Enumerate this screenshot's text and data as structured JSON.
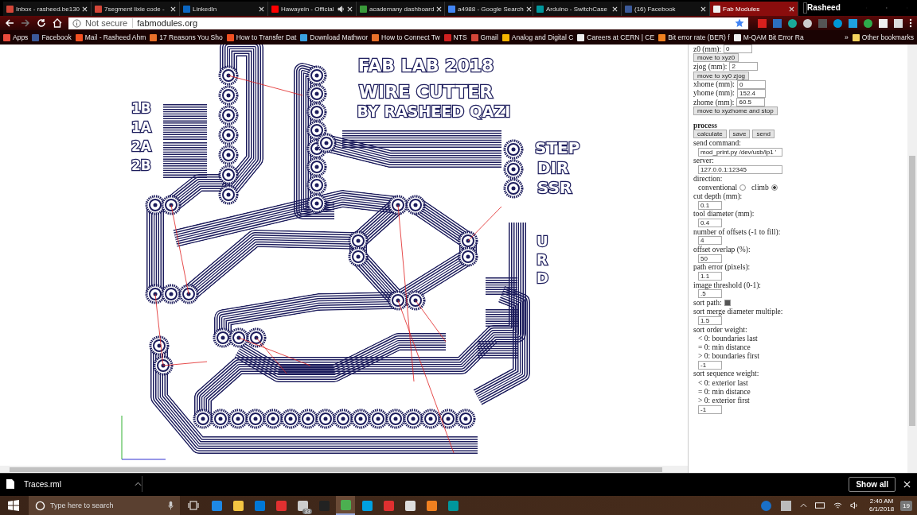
{
  "tabs": [
    {
      "title": "Inbox - rasheed.be130",
      "selected": false,
      "audio": false
    },
    {
      "title": "7segment lixie code -",
      "selected": false,
      "audio": false
    },
    {
      "title": "LinkedIn",
      "selected": false,
      "audio": false
    },
    {
      "title": "Hawayein - Official",
      "selected": false,
      "audio": true
    },
    {
      "title": "academany dashboard",
      "selected": false,
      "audio": false
    },
    {
      "title": "a4988 - Google Search",
      "selected": false,
      "audio": false
    },
    {
      "title": "Arduino - SwitchCase",
      "selected": false,
      "audio": false
    },
    {
      "title": "(16) Facebook",
      "selected": false,
      "audio": false
    },
    {
      "title": "Fab Modules",
      "selected": true,
      "audio": false
    }
  ],
  "profile": "Rasheed",
  "address": {
    "security": "Not secure",
    "url": "fabmodules.org"
  },
  "bookmarks": [
    "Apps",
    "Facebook",
    "Mail - Rasheed Ahm",
    "17 Reasons You Sho",
    "How to Transfer Dat",
    "Download Mathwor",
    "How to Connect Tw",
    "NTS",
    "Gmail",
    "Analog and Digital C",
    "Careers at CERN | CE",
    "Bit error rate (BER) f",
    "M-QAM Bit Error Ra"
  ],
  "bookmarks_more": "»",
  "other_bookmarks": "Other bookmarks",
  "board": {
    "labels": [
      "FAB LAB 2018",
      "WIRE CUTTER",
      "BY RASHEED QAZI",
      "STEP",
      "DIR",
      "SSR",
      "U",
      "R",
      "D",
      "1B",
      "1A",
      "2A",
      "2B"
    ]
  },
  "panel": [
    {
      "kind": "field",
      "label": "z0 (mm):",
      "value": "0"
    },
    {
      "kind": "button",
      "label": "move to xyz0"
    },
    {
      "kind": "field",
      "label": "zjog (mm):",
      "value": "2"
    },
    {
      "kind": "button",
      "label": "move to xy0 zjog"
    },
    {
      "kind": "field",
      "label": "xhome (mm):",
      "value": "0"
    },
    {
      "kind": "field",
      "label": "yhome (mm):",
      "value": "152.4"
    },
    {
      "kind": "field",
      "label": "zhome (mm):",
      "value": "60.5"
    },
    {
      "kind": "button",
      "label": "move to xyzhome and stop"
    },
    {
      "kind": "heading",
      "label": "process"
    },
    {
      "kind": "buttons",
      "labels": [
        "calculate",
        "save",
        "send"
      ]
    },
    {
      "kind": "label",
      "label": "send command:"
    },
    {
      "kind": "longinput",
      "value": "mod_print.py /dev/usb/lp1 '"
    },
    {
      "kind": "label",
      "label": "server:"
    },
    {
      "kind": "longinput",
      "value": "127.0.0.1:12345"
    },
    {
      "kind": "label",
      "label": "direction:"
    },
    {
      "kind": "radio",
      "options": [
        {
          "label": "conventional",
          "selected": false
        },
        {
          "label": "climb",
          "selected": true
        }
      ]
    },
    {
      "kind": "label",
      "label": "cut depth (mm):"
    },
    {
      "kind": "input",
      "value": "0.1"
    },
    {
      "kind": "label",
      "label": "tool diameter (mm):"
    },
    {
      "kind": "input",
      "value": "0.4"
    },
    {
      "kind": "label",
      "label": "number of offsets (-1 to fill):"
    },
    {
      "kind": "input",
      "value": "4"
    },
    {
      "kind": "label",
      "label": "offset overlap (%):"
    },
    {
      "kind": "input",
      "value": "50"
    },
    {
      "kind": "label",
      "label": "path error (pixels):"
    },
    {
      "kind": "input",
      "value": "1.1"
    },
    {
      "kind": "label",
      "label": "image threshold (0-1):"
    },
    {
      "kind": "input",
      "value": ".5"
    },
    {
      "kind": "checkbox",
      "label": "sort path:",
      "checked": true
    },
    {
      "kind": "label",
      "label": "sort merge diameter multiple:"
    },
    {
      "kind": "input",
      "value": "1.5"
    },
    {
      "kind": "label",
      "label": "sort order weight:"
    },
    {
      "kind": "note",
      "label": "< 0: boundaries last"
    },
    {
      "kind": "note",
      "label": "= 0: min distance"
    },
    {
      "kind": "note",
      "label": "> 0: boundaries first"
    },
    {
      "kind": "input",
      "value": "-1"
    },
    {
      "kind": "label",
      "label": "sort sequence weight:"
    },
    {
      "kind": "note",
      "label": "< 0: exterior last"
    },
    {
      "kind": "note",
      "label": "= 0: min distance"
    },
    {
      "kind": "note",
      "label": "> 0: exterior first"
    },
    {
      "kind": "input",
      "value": "-1"
    }
  ],
  "download": {
    "file": "Traces.rml",
    "show_all": "Show all"
  },
  "taskbar": {
    "search_placeholder": "Type here to search",
    "mail_badge": "33",
    "time": "2:40 AM",
    "date": "6/1/2018",
    "notifications": "19"
  }
}
